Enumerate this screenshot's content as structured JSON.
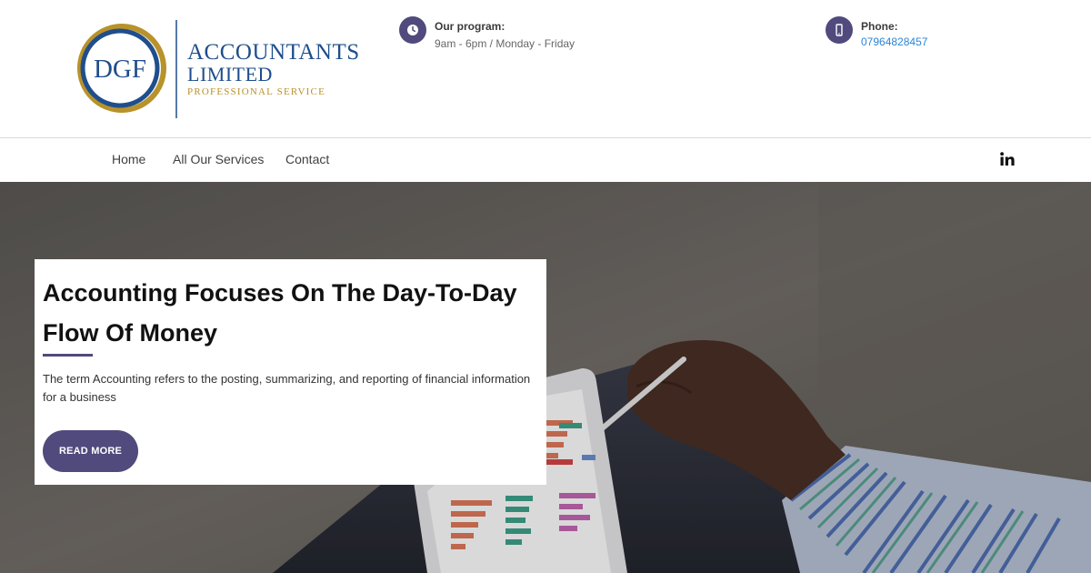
{
  "brand": {
    "logo_initials": "DGF",
    "logo_line1": "ACCOUNTANTS",
    "logo_line2": "LIMITED",
    "logo_line3": "PROFESSIONAL SERVICE"
  },
  "header": {
    "program": {
      "title": "Our program:",
      "value": "9am - 6pm / Monday - Friday",
      "icon": "clock-icon"
    },
    "phone": {
      "title": "Phone:",
      "value": "07964828457",
      "icon": "mobile-phone-icon"
    }
  },
  "nav": {
    "items": [
      {
        "label": "Home"
      },
      {
        "label": "All Our Services"
      },
      {
        "label": "Contact"
      }
    ],
    "social": {
      "icon": "linkedin-icon"
    }
  },
  "hero": {
    "title": "Accounting Focuses On The Day-To-Day Flow Of Money",
    "text": "The term Accounting refers to the posting, summarizing, and reporting of financial information for a business",
    "button_label": "READ MORE"
  },
  "colors": {
    "accent": "#514a7d",
    "link": "#2a86d6",
    "logo_blue": "#1f4e8c",
    "logo_gold": "#b8922a"
  }
}
